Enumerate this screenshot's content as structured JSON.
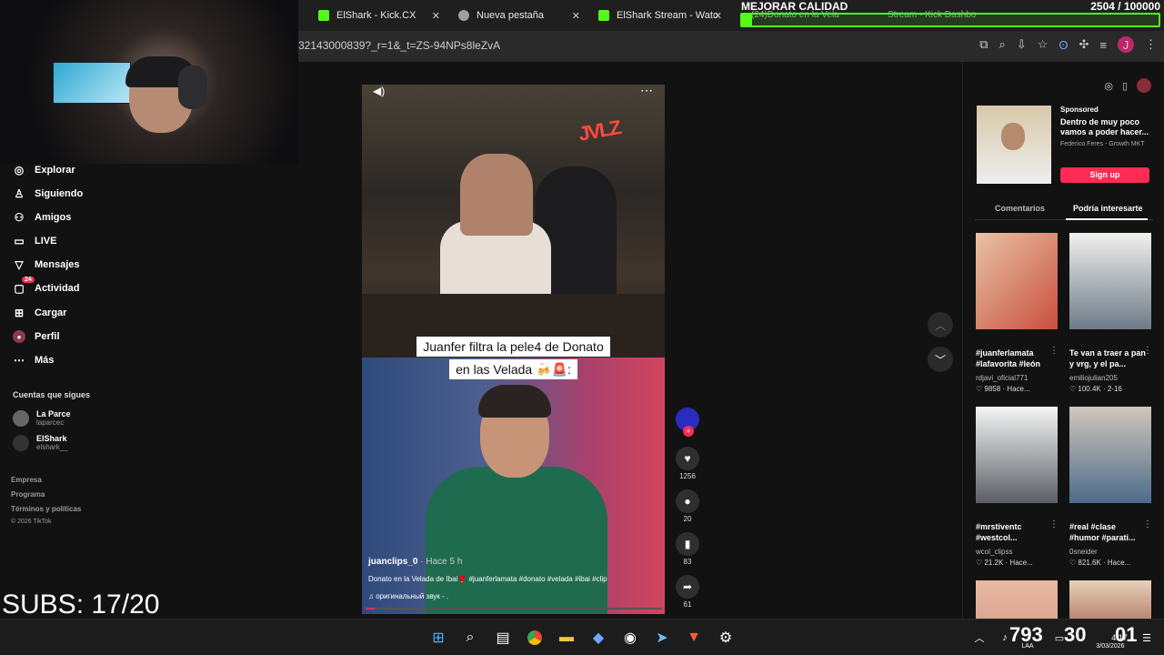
{
  "browser": {
    "tabs": [
      {
        "label": "ElShark - Kick.CX",
        "icon": "kick-icon"
      },
      {
        "label": "Nueva pestaña",
        "icon": "globe-icon"
      },
      {
        "label": "ElShark Stream - Watc",
        "icon": "kick-icon"
      }
    ],
    "ghost_tabs": [
      "(24)Donato en la Vela",
      "Stream - Kick Dashbo"
    ],
    "url": "32143000839?_r=1&_t=ZS-94NPs8leZvA"
  },
  "overlay": {
    "title": "MEJORAR CALIDAD",
    "count": "2504 / 100000",
    "progress": 0.025,
    "subs": "SUBS: 17/20"
  },
  "sidebar": {
    "items": [
      {
        "label": "Explorar",
        "icon": "compass-icon"
      },
      {
        "label": "Siguiendo",
        "icon": "user-follow-icon"
      },
      {
        "label": "Amigos",
        "icon": "friends-icon"
      },
      {
        "label": "LIVE",
        "icon": "live-icon"
      },
      {
        "label": "Mensajes",
        "icon": "send-icon"
      },
      {
        "label": "Actividad",
        "icon": "inbox-icon",
        "badge": "24"
      },
      {
        "label": "Cargar",
        "icon": "upload-icon"
      },
      {
        "label": "Perfil",
        "icon": "profile-icon"
      },
      {
        "label": "Más",
        "icon": "more-icon"
      }
    ],
    "following_title": "Cuentas que sigues",
    "following": [
      {
        "name": "La Parce",
        "user": "laparcec"
      },
      {
        "name": "ElShark",
        "user": "elshark__"
      }
    ],
    "footer": [
      "Empresa",
      "Programa",
      "Términos y políticas",
      "© 2026 TikTok"
    ]
  },
  "video": {
    "caption_line1": "Juanfer filtra la pele4 de Donato",
    "caption_line2": "en las Velada 🍻🚨:",
    "username": "juanclips_0",
    "time": " · Hace 5 h",
    "description": "Donato en la Velada de Ibai🥊 #juanferlamata #donato #velada #ibai #clip",
    "sound": "♫  оригинальный звук - .",
    "progress": 0.03,
    "likes": "1256",
    "comments": "20",
    "saves": "83",
    "shares": "61"
  },
  "rightpanel": {
    "ad_sponsored": "Sponsored",
    "ad_headline": "Dentro de muy poco vamos a poder hacer...",
    "ad_author": "Federico Feres - Growth MKT",
    "ad_button": "Sign up",
    "tab_comments": "Comentarios",
    "tab_interest": "Podría interesarte",
    "thumbs": [
      {
        "caption": "#juanferlamata #lafavorita #león",
        "user": "rdjavi_oficial771",
        "meta": "♡ 9858 · Hace..."
      },
      {
        "caption": "Te van a traer a pan y vrg, y el pa...",
        "user": "emiliojulian205",
        "meta": "♡ 100.4K · 2-16"
      },
      {
        "caption": "#mrstiventc #westcol...",
        "user": "wcol_clipss",
        "meta": "♡ 21.2K · Hace..."
      },
      {
        "caption": "#real #clase #humor #parati...",
        "user": "0sneider",
        "meta": "♡ 821.6K · Hace..."
      }
    ]
  },
  "taskbar": {
    "nums": [
      "793",
      "30",
      "01"
    ],
    "time": "4:17",
    "date": "3/03/2026",
    "lang": "LAA"
  }
}
